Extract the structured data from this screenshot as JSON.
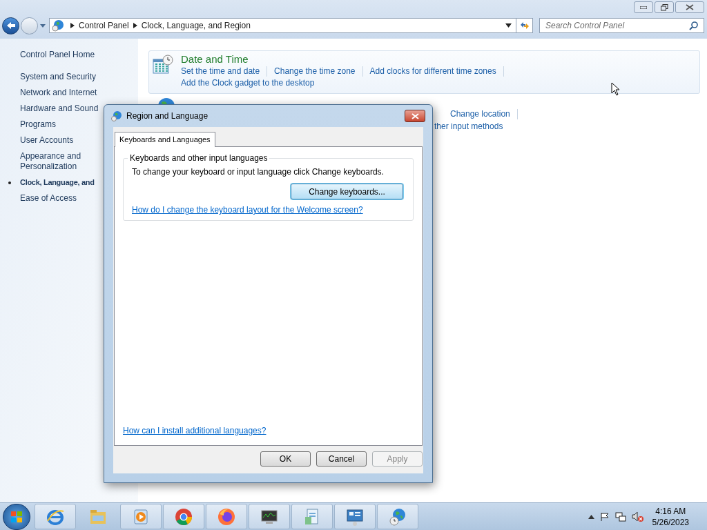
{
  "explorer": {
    "breadcrumb": [
      "Control Panel",
      "Clock, Language, and Region"
    ],
    "search": {
      "placeholder": "Search Control Panel"
    }
  },
  "sidebar": {
    "home": "Control Panel Home",
    "items": [
      {
        "label": "System and Security",
        "selected": false
      },
      {
        "label": "Network and Internet",
        "selected": false
      },
      {
        "label": "Hardware and Sound",
        "selected": false
      },
      {
        "label": "Programs",
        "selected": false
      },
      {
        "label": "User Accounts",
        "selected": false
      },
      {
        "label": "Appearance and Personalization",
        "selected": false
      },
      {
        "label": "Clock, Language, and",
        "selected": true
      },
      {
        "label": "Ease of Access",
        "selected": false
      }
    ]
  },
  "categories": [
    {
      "kind": "clock",
      "title": "Date and Time",
      "link_rows": [
        [
          "Set the time and date",
          "Change the time zone",
          "Add clocks for different time zones"
        ],
        [
          "Add the Clock gadget to the desktop"
        ]
      ]
    },
    {
      "kind": "globe",
      "link_rows": [
        [
          "Change location"
        ],
        [
          "ther input methods"
        ]
      ]
    }
  ],
  "dialog": {
    "title": "Region and Language",
    "tabs": [
      {
        "label": "Keyboards and Languages",
        "selected": true
      }
    ],
    "group_title": "Keyboards and other input languages",
    "instruction": "To change your keyboard or input language click Change keyboards.",
    "change_button": {
      "label": "Change keyboards...",
      "focused": true
    },
    "help_link": "How do I change the keyboard layout for the Welcome screen?",
    "bottom_link": "How can I install additional languages?",
    "buttons": [
      {
        "label": "OK",
        "disabled": false
      },
      {
        "label": "Cancel",
        "disabled": false
      },
      {
        "label": "Apply",
        "disabled": true
      }
    ]
  },
  "taskbar": {
    "time": "4:16 AM",
    "date": "5/26/2023"
  }
}
